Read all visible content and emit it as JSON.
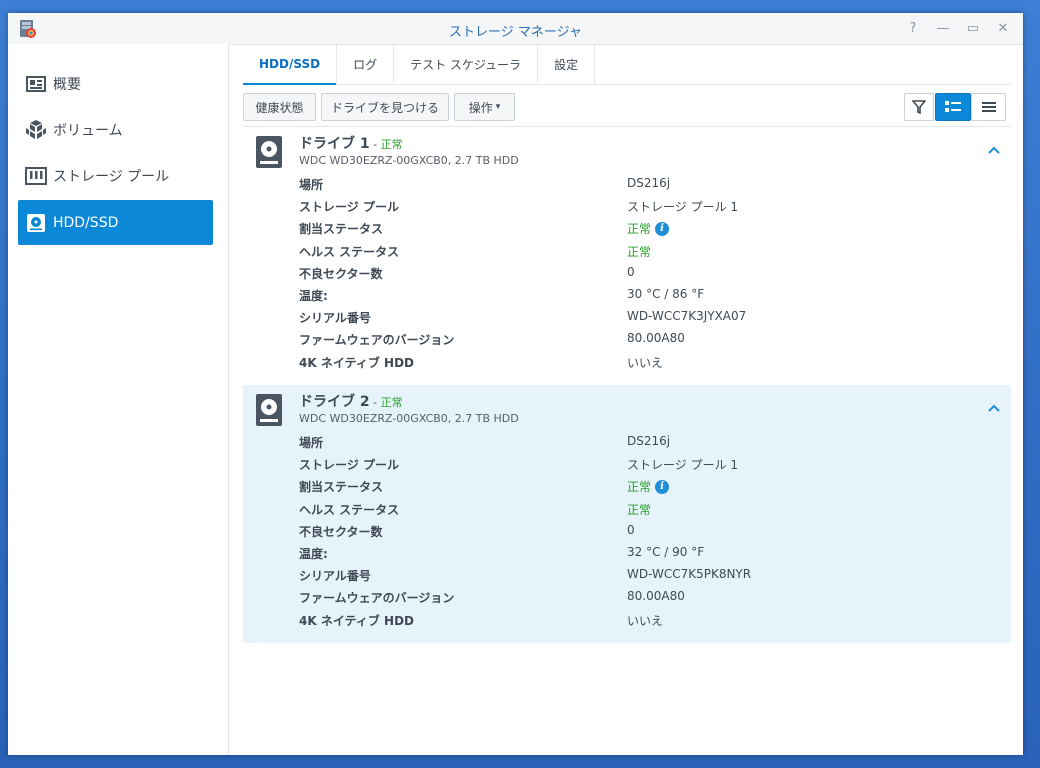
{
  "window": {
    "title": "ストレージ マネージャ"
  },
  "window_controls": [
    "?",
    "—",
    "▭",
    "✕"
  ],
  "sidebar": {
    "items": [
      {
        "label": "概要",
        "icon": "overview-icon"
      },
      {
        "label": "ボリューム",
        "icon": "volume-icon"
      },
      {
        "label": "ストレージ プール",
        "icon": "storage-pool-icon"
      },
      {
        "label": "HDD/SSD",
        "icon": "hdd-icon",
        "active": true
      }
    ]
  },
  "tabs": [
    {
      "label": "HDD/SSD",
      "active": true
    },
    {
      "label": "ログ"
    },
    {
      "label": "テスト スケジューラ"
    },
    {
      "label": "設定"
    }
  ],
  "toolbar": {
    "health_label": "健康状態",
    "locate_label": "ドライブを見つける",
    "action_label": "操作",
    "action_caret": "▾"
  },
  "drives": [
    {
      "name": "ドライブ 1",
      "separator": " - ",
      "status": "正常",
      "model": "WDC WD30EZRZ-00GXCB0, 2.7 TB HDD",
      "rows": [
        {
          "k": "場所",
          "v": "DS216j"
        },
        {
          "k": "ストレージ プール",
          "v": "ストレージ プール 1"
        },
        {
          "k": "割当ステータス",
          "v": "正常",
          "ok": true,
          "info": true
        },
        {
          "k": "ヘルス ステータス",
          "v": "正常",
          "ok": true
        },
        {
          "k": "不良セクター数",
          "v": "0"
        },
        {
          "k": "温度:",
          "v": "30 °C / 86 °F"
        },
        {
          "k": "シリアル番号",
          "v": "WD-WCC7K3JYXA07"
        },
        {
          "k": "ファームウェアのバージョン",
          "v": "80.00A80"
        },
        {
          "k": "4K ネイティブ HDD",
          "v": "いいえ"
        }
      ]
    },
    {
      "name": "ドライブ 2",
      "separator": " - ",
      "status": "正常",
      "model": "WDC WD30EZRZ-00GXCB0, 2.7 TB HDD",
      "rows": [
        {
          "k": "場所",
          "v": "DS216j"
        },
        {
          "k": "ストレージ プール",
          "v": "ストレージ プール 1"
        },
        {
          "k": "割当ステータス",
          "v": "正常",
          "ok": true,
          "info": true
        },
        {
          "k": "ヘルス ステータス",
          "v": "正常",
          "ok": true
        },
        {
          "k": "不良セクター数",
          "v": "0"
        },
        {
          "k": "温度:",
          "v": "32 °C / 90 °F"
        },
        {
          "k": "シリアル番号",
          "v": "WD-WCC7K5PK8NYR"
        },
        {
          "k": "ファームウェアのバージョン",
          "v": "80.00A80"
        },
        {
          "k": "4K ネイティブ HDD",
          "v": "いいえ"
        }
      ]
    }
  ],
  "colors": {
    "accent": "#0b88d8",
    "ok": "#2a9d2a",
    "highlight": "#e6f3fb"
  }
}
